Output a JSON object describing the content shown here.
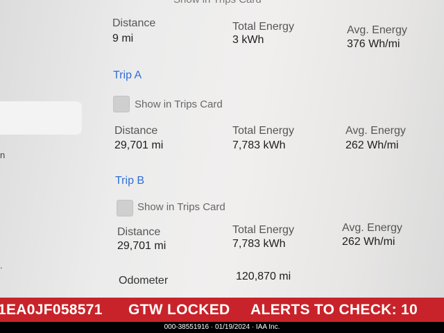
{
  "partial_top_label": "Show in Trips Card",
  "summary": {
    "distance_label": "Distance",
    "distance_value": "9 mi",
    "energy_label": "Total Energy",
    "energy_value": "3 kWh",
    "avg_label": "Avg. Energy",
    "avg_value": "376 Wh/mi"
  },
  "trip_a": {
    "title": "Trip A",
    "checkbox_label": "Show in Trips Card",
    "checked": false,
    "distance_label": "Distance",
    "distance_value": "29,701 mi",
    "energy_label": "Total Energy",
    "energy_value": "7,783 kWh",
    "avg_label": "Avg. Energy",
    "avg_value": "262 Wh/mi"
  },
  "trip_b": {
    "title": "Trip B",
    "checkbox_label": "Show in Trips Card",
    "checked": false,
    "distance_label": "Distance",
    "distance_value": "29,701 mi",
    "energy_label": "Total Energy",
    "energy_value": "7,783 kWh",
    "avg_label": "Avg. Energy",
    "avg_value": "262 Wh/mi"
  },
  "odometer": {
    "label": "Odometer",
    "value": "120,870 mi"
  },
  "banner": {
    "vin": "1EA0JF058571",
    "status": "GTW LOCKED",
    "alerts": "ALERTS TO CHECK: 10"
  },
  "footer_text": "000-38551916 · 01/19/2024 · IAA Inc.",
  "colors": {
    "accent_blue": "#2e6fd6",
    "banner_red": "#c8232a"
  }
}
